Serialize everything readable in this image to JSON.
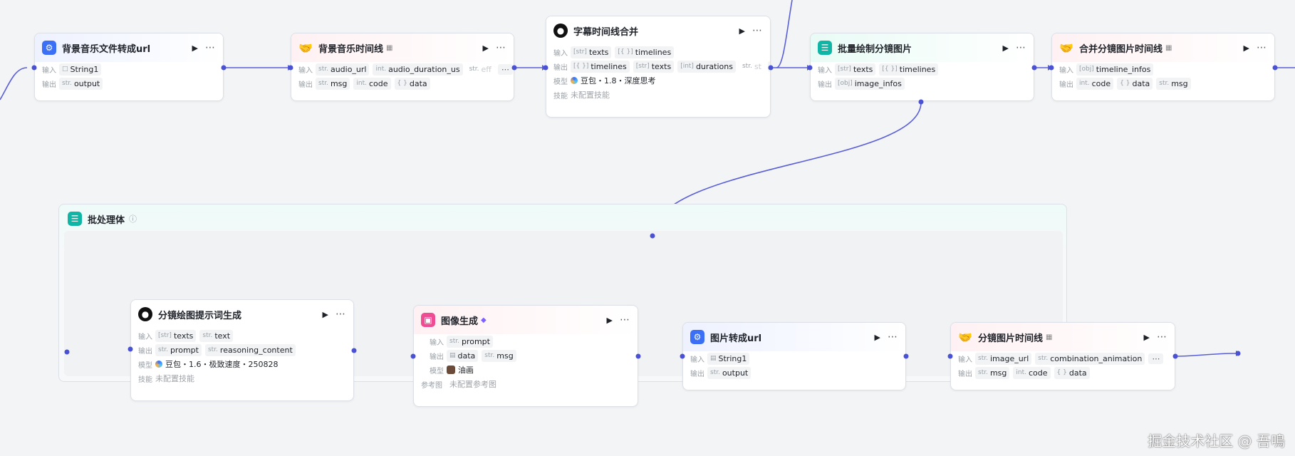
{
  "labels": {
    "input": "输入",
    "output": "输出",
    "model": "模型",
    "skill": "技能",
    "ref_image": "参考图"
  },
  "nodes": {
    "bgm_to_url": {
      "title": "背景音乐文件转成url",
      "inputs": [
        {
          "type": "",
          "name": "String1"
        }
      ],
      "outputs": [
        {
          "type": "str.",
          "name": "output"
        }
      ]
    },
    "bgm_timeline": {
      "title": "背景音乐时间线",
      "inputs": [
        {
          "type": "str.",
          "name": "audio_url"
        },
        {
          "type": "int.",
          "name": "audio_duration_us"
        },
        {
          "type": "str.",
          "name": "eff"
        }
      ],
      "outputs": [
        {
          "type": "str.",
          "name": "msg"
        },
        {
          "type": "int.",
          "name": "code"
        },
        {
          "type": "{ }",
          "name": "data"
        }
      ]
    },
    "subtitle_merge": {
      "title": "字幕时间线合并",
      "inputs": [
        {
          "type": "[str]",
          "name": "texts"
        },
        {
          "type": "[{ }]",
          "name": "timelines"
        }
      ],
      "outputs": [
        {
          "type": "[{ }]",
          "name": "timelines"
        },
        {
          "type": "[str]",
          "name": "texts"
        },
        {
          "type": "[int]",
          "name": "durations"
        },
        {
          "type": "str.",
          "name": "st"
        }
      ],
      "model": "豆包・1.8・深度思考",
      "skill": "未配置技能"
    },
    "batch_draw": {
      "title": "批量绘制分镜图片",
      "inputs": [
        {
          "type": "[str]",
          "name": "texts"
        },
        {
          "type": "[{ }]",
          "name": "timelines"
        }
      ],
      "outputs": [
        {
          "type": "[obj]",
          "name": "image_infos"
        }
      ]
    },
    "merge_timeline": {
      "title": "合并分镜图片时间线",
      "inputs": [
        {
          "type": "[obj]",
          "name": "timeline_infos"
        }
      ],
      "outputs": [
        {
          "type": "int.",
          "name": "code"
        },
        {
          "type": "{ }",
          "name": "data"
        },
        {
          "type": "str.",
          "name": "msg"
        }
      ]
    },
    "prompt_gen": {
      "title": "分镜绘图提示词生成",
      "inputs": [
        {
          "type": "[str]",
          "name": "texts"
        },
        {
          "type": "str.",
          "name": "text"
        }
      ],
      "outputs": [
        {
          "type": "str.",
          "name": "prompt"
        },
        {
          "type": "str.",
          "name": "reasoning_content"
        }
      ],
      "model": "豆包・1.6・极致速度・250828",
      "skill": "未配置技能"
    },
    "image_gen": {
      "title": "图像生成",
      "inputs": [
        {
          "type": "str.",
          "name": "prompt"
        }
      ],
      "outputs": [
        {
          "type": "img",
          "name": "data"
        },
        {
          "type": "str.",
          "name": "msg"
        }
      ],
      "model": "油画",
      "ref_image": "未配置参考图"
    },
    "img_to_url": {
      "title": "图片转成url",
      "inputs": [
        {
          "type": "img",
          "name": "String1"
        }
      ],
      "outputs": [
        {
          "type": "str.",
          "name": "output"
        }
      ]
    },
    "storyboard_timeline": {
      "title": "分镜图片时间线",
      "inputs": [
        {
          "type": "str.",
          "name": "image_url"
        },
        {
          "type": "str.",
          "name": "combination_animation"
        }
      ],
      "outputs": [
        {
          "type": "str.",
          "name": "msg"
        },
        {
          "type": "int.",
          "name": "code"
        },
        {
          "type": "{ }",
          "name": "data"
        }
      ]
    }
  },
  "group": {
    "title": "批处理体"
  },
  "watermark": "掘金技术社区 @ 吾鳴",
  "colors": {
    "wire": "#5a5fd8",
    "port": "#4a52d4",
    "canvas": "#f3f4f6"
  }
}
